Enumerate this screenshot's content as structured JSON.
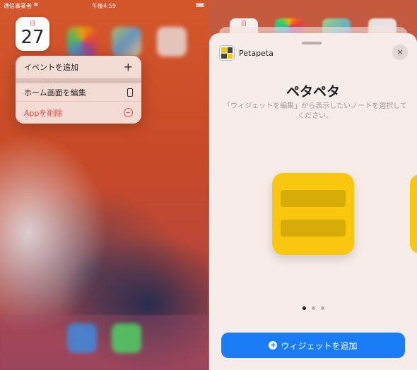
{
  "left_screen": {
    "status_bar": {
      "carrier": "通信事業者",
      "time": "午後4:59"
    },
    "calendar_icon": {
      "weekday": "日",
      "date": "27"
    },
    "context_menu": {
      "items": [
        {
          "label": "イベントを追加",
          "icon": "plus-icon"
        },
        {
          "label": "ホーム画面を編集",
          "icon": "phone-icon"
        },
        {
          "label": "Appを削除",
          "icon": "minus-circle-icon",
          "color": "#e5483e"
        }
      ]
    }
  },
  "right_screen": {
    "top_icon_label": "日",
    "widget_sheet": {
      "app_name": "Petapeta",
      "title": "ペタペタ",
      "description": "「ウィジェットを編集」から表示したいノートを選択してください。",
      "page_indicator": {
        "pages": 3,
        "current": 1
      },
      "add_button_label": "ウィジェットを追加",
      "accent_color": "#1a7cf6",
      "widget_color": "#f9c80e"
    }
  }
}
